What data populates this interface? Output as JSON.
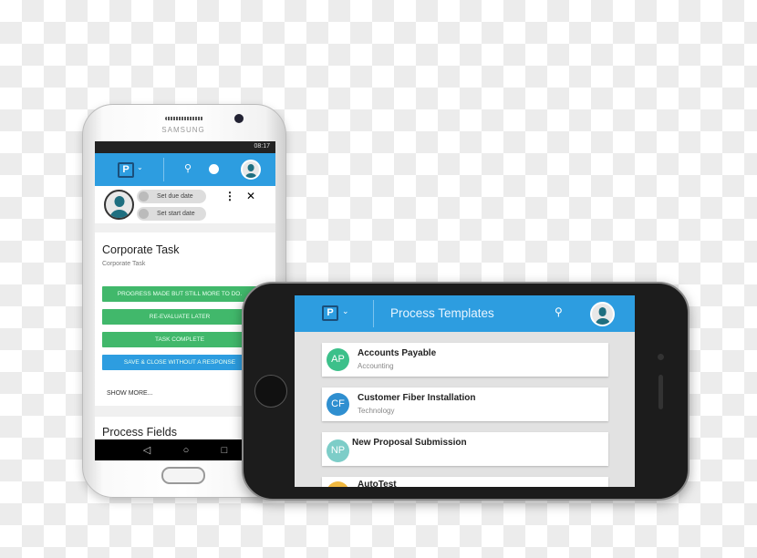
{
  "android": {
    "status_time": "08:17",
    "header": {
      "logo": "P"
    },
    "chips": [
      "Set due date",
      "Set start date"
    ],
    "task_title": "Corporate Task",
    "task_subtitle": "Corporate Task",
    "buttons": [
      "PROGRESS MADE BUT STILL MORE TO DO.",
      "RE-EVALUATE LATER",
      "TASK COMPLETE",
      "SAVE & CLOSE WITHOUT A RESPONSE"
    ],
    "show_more": "SHOW MORE...",
    "section_title": "Process Fields",
    "nav": [
      "◁",
      "○",
      "□"
    ],
    "brand": "SAMSUNG"
  },
  "iphone": {
    "header": {
      "logo": "P",
      "title": "Process Templates"
    },
    "items": [
      {
        "initials": "AP",
        "title": "Accounts Payable",
        "subtitle": "Accounting",
        "color": "#3cc08a"
      },
      {
        "initials": "CF",
        "title": "Customer Fiber Installation",
        "subtitle": "Technology",
        "color": "#2f8fd0"
      },
      {
        "initials": "NP",
        "title": "New Proposal Submission",
        "subtitle": "",
        "color": "#7dcdc8"
      },
      {
        "initials": "",
        "title": "AutoTest",
        "subtitle": "",
        "color": "#f0b840"
      }
    ]
  },
  "colors": {
    "primary": "#2d9de0",
    "green": "#41b86b"
  }
}
